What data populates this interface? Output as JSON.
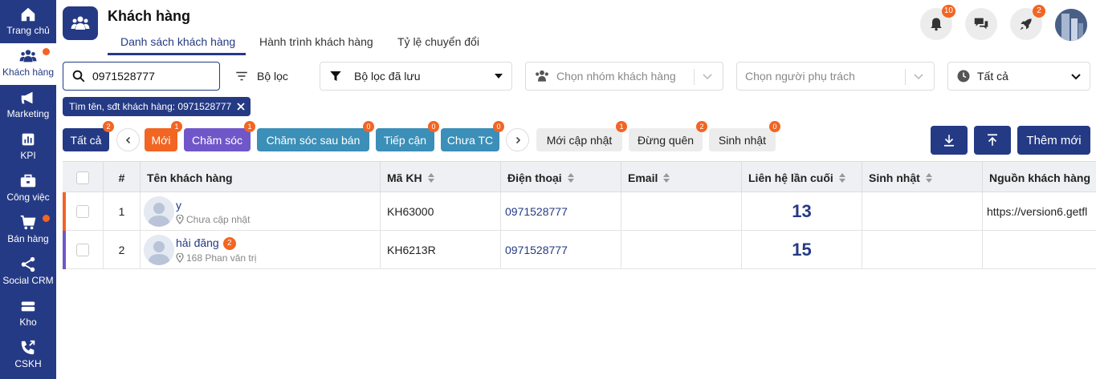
{
  "sidebar": {
    "items": [
      {
        "label": "Trang chủ",
        "icon": "home-icon"
      },
      {
        "label": "Khách hàng",
        "icon": "users-icon"
      },
      {
        "label": "Marketing",
        "icon": "megaphone-icon"
      },
      {
        "label": "KPI",
        "icon": "chart-icon"
      },
      {
        "label": "Công việc",
        "icon": "briefcase-icon"
      },
      {
        "label": "Bán hàng",
        "icon": "cart-icon"
      },
      {
        "label": "Social CRM",
        "icon": "share-icon"
      },
      {
        "label": "Kho",
        "icon": "warehouse-icon"
      },
      {
        "label": "CSKH",
        "icon": "phone-icon"
      }
    ]
  },
  "header": {
    "title": "Khách hàng",
    "tabs": [
      "Danh sách khách hàng",
      "Hành trình khách hàng",
      "Tỷ lệ chuyển đổi"
    ],
    "notifications_count": "10",
    "rocket_count": "2"
  },
  "filters": {
    "search_value": "0971528777",
    "filter_label": "Bộ lọc",
    "saved_filter_label": "Bộ lọc đã lưu",
    "group_placeholder": "Chọn nhóm khách hàng",
    "owner_placeholder": "Chọn người phụ trách",
    "time_value": "Tất cả",
    "active_chip": "Tìm tên, sđt khách hàng: 0971528777"
  },
  "statuses": [
    {
      "label": "Tất cả",
      "count": "2"
    },
    {
      "label": "Mới",
      "count": "1"
    },
    {
      "label": "Chăm sóc",
      "count": "1"
    },
    {
      "label": "Chăm sóc sau bán",
      "count": "0"
    },
    {
      "label": "Tiếp cận",
      "count": "0"
    },
    {
      "label": "Chưa TC",
      "count": "0"
    },
    {
      "label": "Mới cập nhật",
      "count": "1"
    },
    {
      "label": "Đừng quên",
      "count": "2"
    },
    {
      "label": "Sinh nhật",
      "count": "0"
    }
  ],
  "actions": {
    "add_label": "Thêm mới"
  },
  "colors": {
    "primary": "#253a84",
    "badge": "#f26522",
    "status_new": "#f26522",
    "status_care": "#7057c9",
    "status_teal": "#3b8fb8"
  },
  "table": {
    "headers": [
      "#",
      "Tên khách hàng",
      "Mã KH",
      "Điện thoại",
      "Email",
      "Liên hệ lần cuối",
      "Sinh nhật",
      "Nguồn khách hàng"
    ],
    "rows": [
      {
        "index": "1",
        "name": "y",
        "name_badge": "",
        "address": "Chưa cập nhật",
        "code": "KH63000",
        "phone": "0971528777",
        "email": "",
        "last_contact": "13",
        "birthday": "",
        "source": "https://version6.getfl",
        "bar_color": "#f26522"
      },
      {
        "index": "2",
        "name": "hải đăng",
        "name_badge": "2",
        "address": "168 Phan văn trị",
        "code": "KH6213R",
        "phone": "0971528777",
        "email": "",
        "last_contact": "15",
        "birthday": "",
        "source": "",
        "bar_color": "#7057c9"
      }
    ]
  }
}
